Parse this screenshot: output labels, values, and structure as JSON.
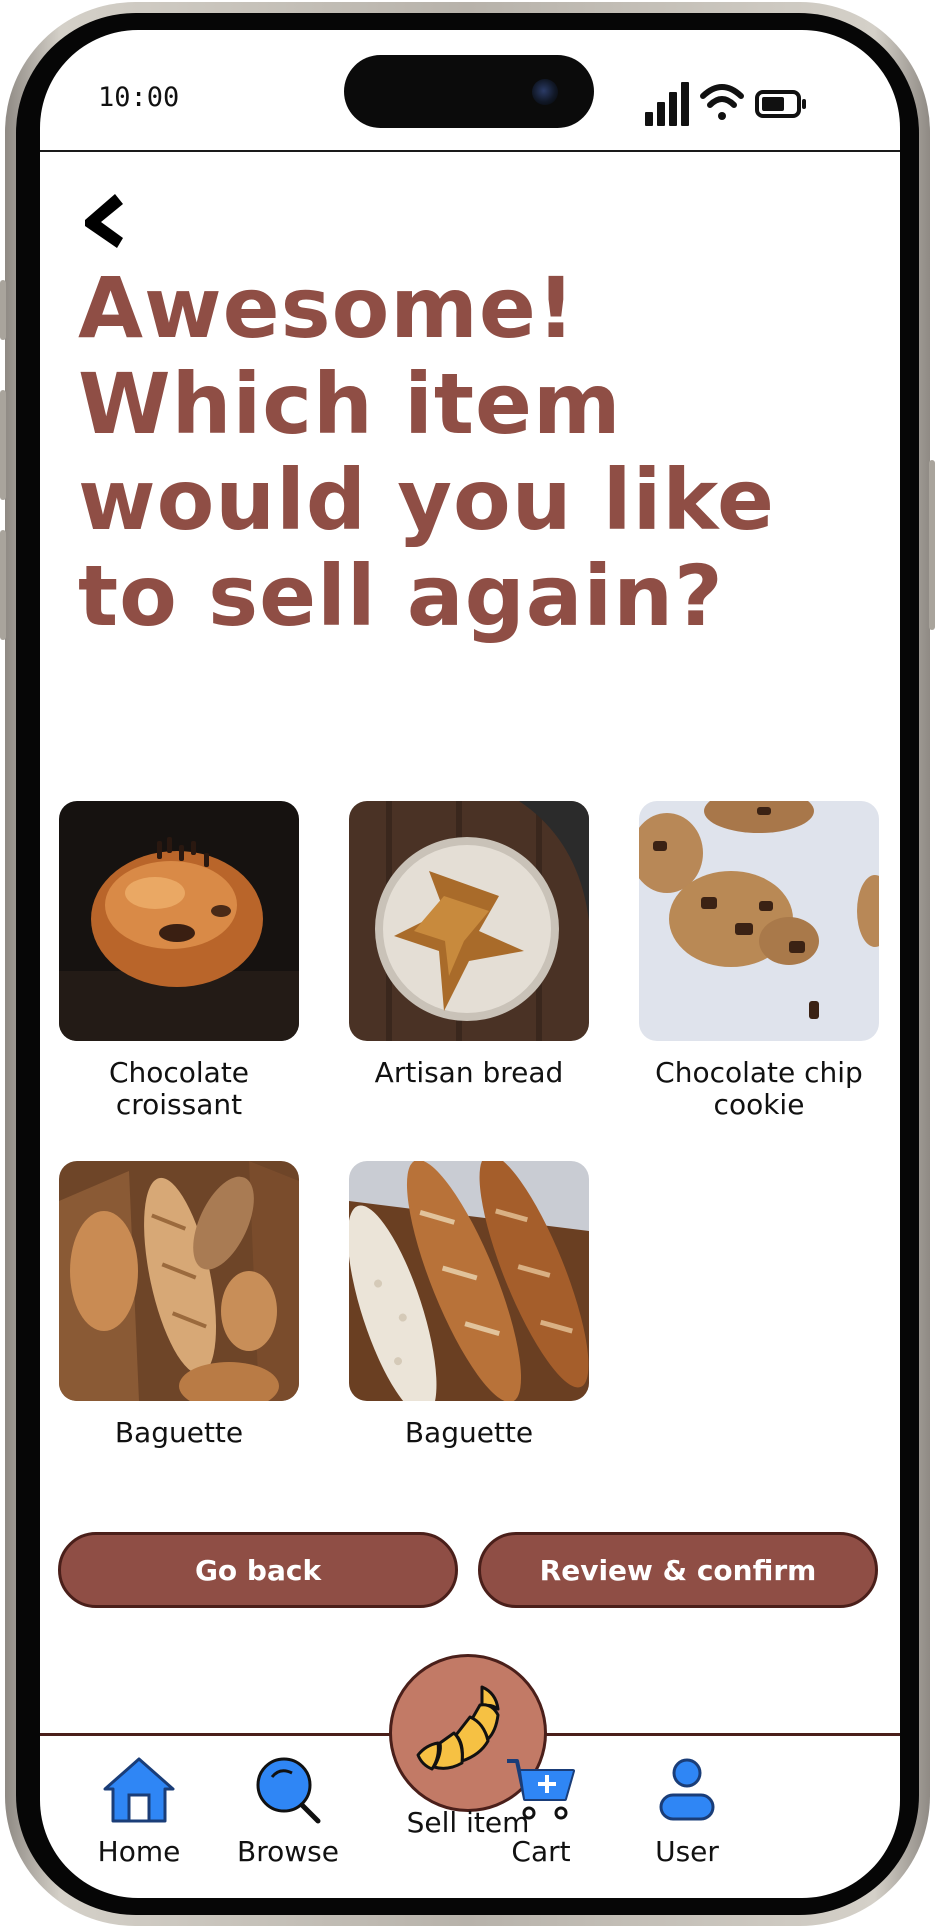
{
  "status_bar": {
    "time": "10:00"
  },
  "header": {
    "title": "Awesome! Which item would you like to sell again?"
  },
  "items": [
    {
      "name": "Chocolate croissant",
      "image": "chocolate-croissant-photo"
    },
    {
      "name": "Artisan bread",
      "image": "artisan-bread-photo"
    },
    {
      "name": "Chocolate chip cookie",
      "image": "chocolate-chip-cookie-photo"
    },
    {
      "name": "Baguette",
      "image": "baguettes-in-bag-photo"
    },
    {
      "name": "Baguette",
      "image": "baguettes-on-board-photo"
    }
  ],
  "actions": {
    "go_back": "Go back",
    "review_confirm": "Review & confirm"
  },
  "nav": {
    "home": "Home",
    "browse": "Browse",
    "sell": "Sell item",
    "cart": "Cart",
    "user": "User"
  },
  "colors": {
    "accent": "#8f4e45",
    "accent_dark": "#4a1f1a",
    "fab": "#c27a66",
    "nav_icon": "#2f86f5",
    "croissant": "#f6c143"
  },
  "icons": {
    "back": "chevron-left-icon",
    "home": "home-icon",
    "browse": "search-icon",
    "sell": "croissant-icon",
    "cart": "cart-add-icon",
    "user": "user-icon"
  }
}
